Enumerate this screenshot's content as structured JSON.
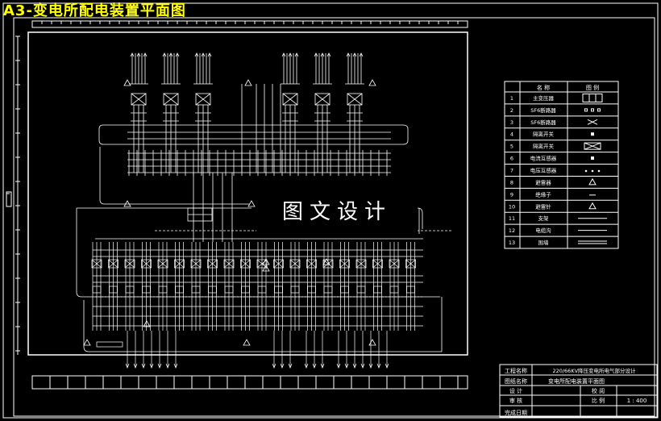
{
  "page": {
    "title": "A3-变电所配电装置平面图",
    "watermark": "图文设计"
  },
  "legend": {
    "headers": [
      "名 称",
      "图 例"
    ],
    "rows": [
      {
        "no": "1",
        "name": "主变压器",
        "icon": "transformer-symbol"
      },
      {
        "no": "2",
        "name": "SF6断路器",
        "icon": "three-dots-symbol"
      },
      {
        "no": "3",
        "name": "SF6断路器",
        "icon": "x-mark-symbol"
      },
      {
        "no": "4",
        "name": "隔离开关",
        "icon": "small-square-symbol"
      },
      {
        "no": "5",
        "name": "隔离开关",
        "icon": "boxed-x-symbol"
      },
      {
        "no": "6",
        "name": "电流互感器",
        "icon": "small-square-symbol"
      },
      {
        "no": "7",
        "name": "电压互感器",
        "icon": "dots-row-symbol"
      },
      {
        "no": "8",
        "name": "避雷器",
        "icon": "triangle-symbol"
      },
      {
        "no": "9",
        "name": "绝缘子",
        "icon": "bar-symbol"
      },
      {
        "no": "10",
        "name": "避雷针",
        "icon": "triangle-symbol"
      },
      {
        "no": "11",
        "name": "支架",
        "icon": "line-symbol"
      },
      {
        "no": "12",
        "name": "电缆沟",
        "icon": "line-symbol"
      },
      {
        "no": "13",
        "name": "围墙",
        "icon": "double-line-symbol"
      }
    ]
  },
  "title_block": {
    "r1_label": "工程名称",
    "r1_value": "220/66KV降压变电所电气部分设计",
    "r2_label": "图纸名称",
    "r2_value": "变电所配电装置平面图",
    "r3_label": "设 计",
    "r3_mid": "校 阅",
    "r4_label": "审 核",
    "r4_mid": "比 例",
    "r4_value": "1 : 400",
    "r5_label": "完成日期"
  },
  "colors": {
    "background": "#000000",
    "lines": "#ffffff",
    "title": "#ffff00"
  }
}
